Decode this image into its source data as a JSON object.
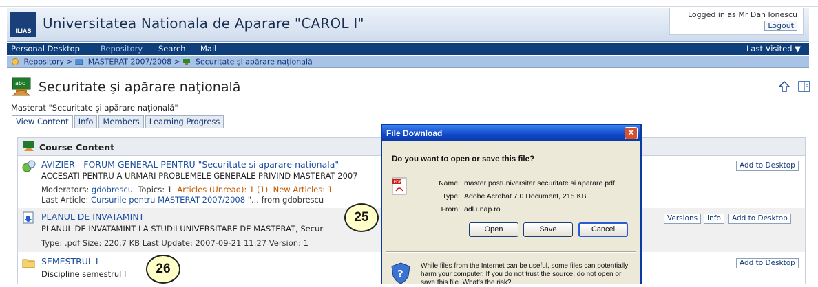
{
  "header": {
    "logo_text": "ILIAS",
    "site_title": "Universitatea Nationala de Aparare \"CAROL I\"",
    "login_status": "Logged in as Mr Dan Ionescu",
    "logout_label": "Logout"
  },
  "nav": {
    "items": [
      "Personal Desktop",
      "Repository",
      "Search",
      "Mail"
    ],
    "active": "Repository",
    "last_visited": "Last Visited ▼"
  },
  "breadcrumb": {
    "items": [
      "Repository",
      "MASTERAT 2007/2008",
      "Securitate şi apărare naţională"
    ],
    "separator": ">"
  },
  "page": {
    "title": "Securitate şi apărare naţională",
    "description": "Masterat \"Securitate şi apărare naţională\""
  },
  "tabs": [
    "View Content",
    "Info",
    "Members",
    "Learning Progress"
  ],
  "content": {
    "header": "Course Content",
    "forum": {
      "title": "AVIZIER - FORUM GENERAL PENTRU \"Securitate si aparare nationala\"",
      "description": "ACCESATI PENTRU A URMARI PROBLEMELE GENERALE PRIVIND MASTERAT 2007",
      "moderators_label": "Moderators:",
      "moderator": "gdobrescu",
      "topics": "Topics: 1",
      "articles_unread": "Articles (Unread): 1 (1)",
      "new_articles": "New Articles: 1",
      "last_article_label": "Last Article:",
      "last_article": "Cursurile pentru MASTERAT 2007/2008",
      "last_article_suffix": "\"... from gdobrescu",
      "action": "Add to Desktop"
    },
    "file": {
      "title": "PLANUL DE INVATAMINT",
      "description": "PLANUL DE INVATAMINT LA STUDII UNIVERSITARE DE MASTERAT, Secur",
      "meta": "Type: .pdf   Size: 220.7 KB   Last Update: 2007-09-21 11:27   Version: 1",
      "actions": [
        "Versions",
        "Info",
        "Add to Desktop"
      ]
    },
    "folder": {
      "title": "SEMESTRUL I",
      "description": "Discipline semestrul I",
      "action": "Add to Desktop"
    }
  },
  "callouts": [
    "25",
    "26"
  ],
  "dialog": {
    "title": "File Download",
    "question": "Do you want to open or save this file?",
    "name_label": "Name:",
    "name": "master postuniversitar securitate si aparare.pdf",
    "type_label": "Type:",
    "type": "Adobe Acrobat 7.0 Document, 215 KB",
    "from_label": "From:",
    "from": "adl.unap.ro",
    "buttons": [
      "Open",
      "Save",
      "Cancel"
    ],
    "warning": "While files from the Internet can be useful, some files can potentially harm your computer. If you do not trust the source, do not open or save this file. What's the risk?",
    "pdf_badge": "PDF",
    "close_glyph": "✕"
  },
  "colors": {
    "nav_bg": "#0f3f7b",
    "breadcrumb_bg": "#a8c3e6",
    "link": "#1b4ea0",
    "dialog_title": "#1047c8"
  }
}
